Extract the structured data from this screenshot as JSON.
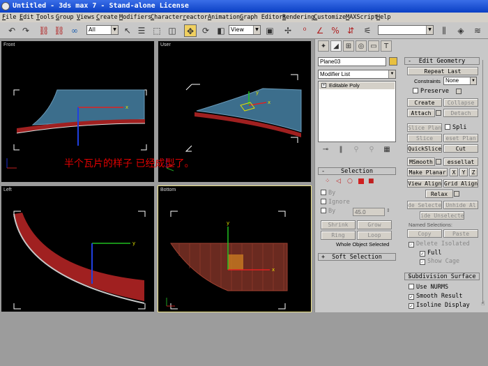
{
  "window": {
    "title": "Untitled   - 3ds max 7   - Stand-alone License"
  },
  "menu": [
    "File",
    "Edit",
    "Tools",
    "Group",
    "Views",
    "Create",
    "Modifiers",
    "Character",
    "reactor",
    "Animation",
    "Graph Editors",
    "Rendering",
    "Customize",
    "MAXScript",
    "Help"
  ],
  "toolbar": {
    "selection_filter": "All",
    "ref_coord": "View"
  },
  "viewports": {
    "front": "Front",
    "top": "User",
    "left": "Left",
    "bottom": "Bottom"
  },
  "annotation": "半个瓦片的样子 已经成型了。",
  "command_panel": {
    "object_name": "Plane03",
    "modifier_list": "Modifier List",
    "stack_item": "Editable Poly",
    "edit_geometry": {
      "title": "Edit Geometry",
      "repeat_last": "Repeat Last",
      "constraints_label": "Constraints",
      "constraints_value": "None",
      "preserve": "Preserve",
      "create": "Create",
      "collapse": "Collapse",
      "attach": "Attach",
      "detach": "Detach",
      "slice_plane": "Slice Plan",
      "split": "Spli",
      "slice": "Slice",
      "reset_plane": "eset Plan",
      "quickslice": "QuickSlice",
      "cut": "Cut",
      "msmooth": "MSmooth",
      "tessellate": "essellat",
      "make_planar": "Make Planar",
      "x": "X",
      "y": "Y",
      "z": "Z",
      "view_align": "View Align",
      "grid_align": "Grid Align",
      "relax": "Relax",
      "hide_selected": "de Selecte",
      "unhide_all": "Unhide Al",
      "hide_unselected": "ide Unselecte",
      "named_selections": "Named Selections:",
      "copy": "Copy",
      "paste": "Paste",
      "delete_isolated": "Delete Isolated",
      "full": "Full",
      "show_cage": "Show Cage"
    },
    "selection": {
      "title": "Selection",
      "by_vertex": "By",
      "ignore": "Ignore",
      "by_angle": "By",
      "angle_value": "45.0",
      "shrink": "Shrink",
      "grow": "Grow",
      "ring": "Ring",
      "loop": "Loop",
      "status": "Whole Object Selected"
    },
    "soft_selection": {
      "title": "Soft Selection"
    },
    "subdivision": {
      "title": "Subdivision Surface",
      "use_nurms": "Use NURMS",
      "smooth_result": "Smooth Result",
      "isoline_display": "Isoline Display"
    },
    "rollout_open": "-",
    "rollout_closed": "+"
  },
  "colors": {
    "accent": "#3a6ee8",
    "viewport_bg": "#000000",
    "annotation": "#e00000",
    "tile_blue": "#3c6e8c",
    "tile_red": "#a02020"
  }
}
